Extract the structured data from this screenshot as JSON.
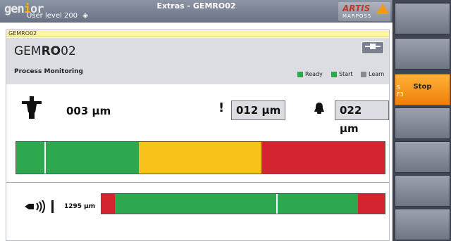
{
  "header": {
    "logo_text": "genior",
    "user_level_label": "User level",
    "user_level_value": "200",
    "title": "Extras - GEMRO02",
    "brand_name": "ARTIS",
    "brand_sub": "MARPOSS"
  },
  "panel": {
    "breadcrumb": "GEMRO02",
    "title_prefix": "GEM",
    "title_bold": "RO",
    "title_suffix": "02",
    "section_label": "Process Monitoring",
    "legend": [
      {
        "label": "Ready",
        "color": "#2ea84f"
      },
      {
        "label": "Start",
        "color": "#2ea84f"
      },
      {
        "label": "Learn",
        "color": "#8a8a8a"
      }
    ]
  },
  "measure": {
    "current_value": "003 μm",
    "warning_value": "012 μm",
    "alarm_value": "022 μm",
    "bar_segments": [
      {
        "color": "#2ea84f",
        "fraction": 0.333
      },
      {
        "color": "#f7c21a",
        "fraction": 0.333
      },
      {
        "color": "#d42430",
        "fraction": 0.334
      }
    ],
    "marker_fraction": 0.077
  },
  "acoustic": {
    "value": "1295 μm",
    "bar_segments": [
      {
        "color": "#d42430",
        "fraction": 0.048
      },
      {
        "color": "#2ea84f",
        "fraction": 0.857
      },
      {
        "color": "#d42430",
        "fraction": 0.095
      }
    ],
    "marker_fraction": 0.616
  },
  "softkeys": [
    {
      "label": "",
      "active": false
    },
    {
      "label": "",
      "active": false
    },
    {
      "label": "Stop",
      "corner": "S\nF3",
      "active": true
    },
    {
      "label": "",
      "active": false
    },
    {
      "label": "",
      "active": false
    },
    {
      "label": "",
      "active": false
    },
    {
      "label": "",
      "active": false
    }
  ],
  "icons": {
    "probe": "probe-icon",
    "warning": "exclamation-icon",
    "alarm": "bell-icon",
    "acoustic": "speaker-icon",
    "plug": "plug-icon",
    "user_level": "diamond-arrow-icon"
  },
  "colors": {
    "accent_orange": "#ef7f0a",
    "green": "#2ea84f",
    "yellow": "#f7c21a",
    "red": "#d42430"
  }
}
